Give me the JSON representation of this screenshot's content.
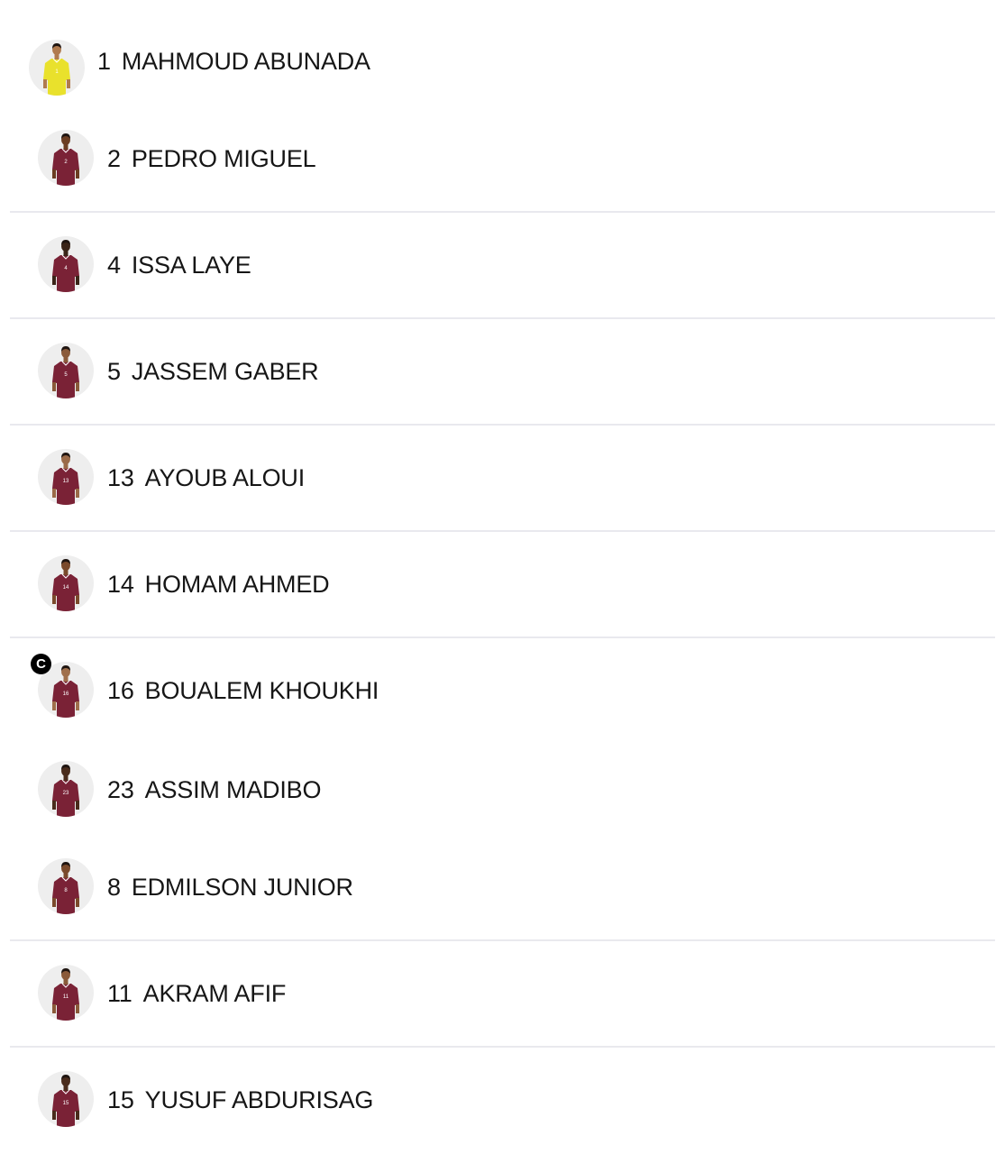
{
  "lineup": {
    "captain_badge": "C",
    "players": [
      {
        "number": "1",
        "name": "MAHMOUD ABUNADA",
        "avatar_icon": "goalkeeper-player-photo",
        "kit_color": "#e9e12c",
        "skin_color": "#b07a4e"
      },
      {
        "number": "2",
        "name": "PEDRO MIGUEL",
        "avatar_icon": "player-photo",
        "kit_color": "#7a2236",
        "skin_color": "#6b3d22"
      },
      {
        "number": "4",
        "name": "ISSA LAYE",
        "avatar_icon": "player-photo",
        "kit_color": "#7a2236",
        "skin_color": "#3a2418"
      },
      {
        "number": "5",
        "name": "JASSEM GABER",
        "avatar_icon": "player-photo",
        "kit_color": "#7a2236",
        "skin_color": "#8a5a3a"
      },
      {
        "number": "13",
        "name": "AYOUB ALOUI",
        "avatar_icon": "player-photo",
        "kit_color": "#7a2236",
        "skin_color": "#9a6a48"
      },
      {
        "number": "14",
        "name": "HOMAM AHMED",
        "avatar_icon": "player-photo",
        "kit_color": "#7a2236",
        "skin_color": "#7a4a2c"
      },
      {
        "number": "16",
        "name": "BOUALEM KHOUKHI",
        "avatar_icon": "player-photo",
        "kit_color": "#7a2236",
        "skin_color": "#a0704c",
        "captain": true
      },
      {
        "number": "23",
        "name": "ASSIM MADIBO",
        "avatar_icon": "player-photo",
        "kit_color": "#7a2236",
        "skin_color": "#4a2c1c"
      },
      {
        "number": "8",
        "name": "EDMILSON JUNIOR",
        "avatar_icon": "player-photo",
        "kit_color": "#7a2236",
        "skin_color": "#7a4a2c"
      },
      {
        "number": "11",
        "name": "AKRAM AFIF",
        "avatar_icon": "player-photo",
        "kit_color": "#7a2236",
        "skin_color": "#8a5a3a"
      },
      {
        "number": "15",
        "name": "YUSUF ABDURISAG",
        "avatar_icon": "player-photo",
        "kit_color": "#7a2236",
        "skin_color": "#4a2c1c"
      }
    ]
  }
}
